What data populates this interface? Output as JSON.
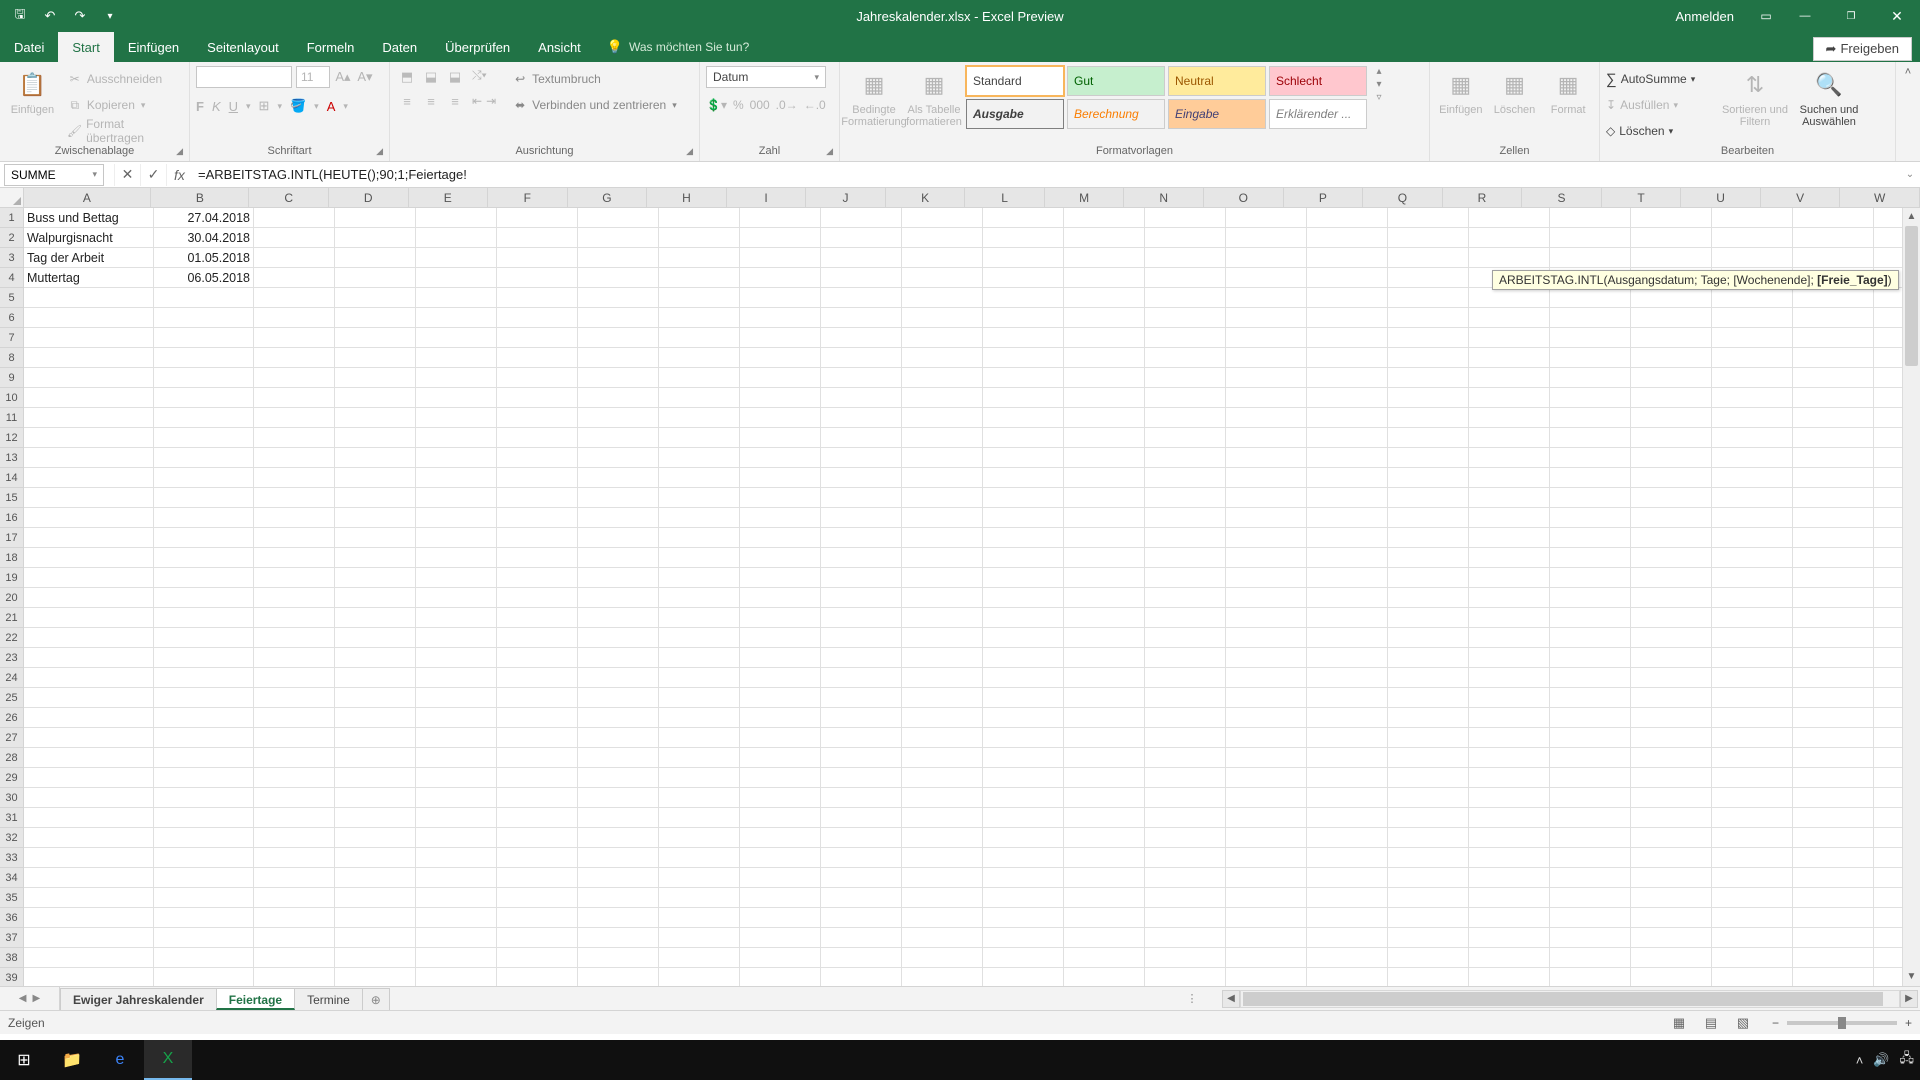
{
  "titlebar": {
    "title": "Jahreskalender.xlsx - Excel Preview",
    "anmelden": "Anmelden"
  },
  "tabs": {
    "file": "Datei",
    "start": "Start",
    "einfuegen": "Einfügen",
    "seitenlayout": "Seitenlayout",
    "formeln": "Formeln",
    "daten": "Daten",
    "ueberpruefen": "Überprüfen",
    "ansicht": "Ansicht",
    "tellme": "Was möchten Sie tun?",
    "share": "Freigeben"
  },
  "ribbon": {
    "clipboard": {
      "label": "Zwischenablage",
      "einfuegen": "Einfügen",
      "ausschneiden": "Ausschneiden",
      "kopieren": "Kopieren",
      "format": "Format übertragen"
    },
    "font": {
      "label": "Schriftart",
      "name": "",
      "size": "11"
    },
    "alignment": {
      "label": "Ausrichtung",
      "wrap": "Textumbruch",
      "merge": "Verbinden und zentrieren"
    },
    "number": {
      "label": "Zahl",
      "format": "Datum"
    },
    "styles": {
      "label": "Formatvorlagen",
      "bedingte": "Bedingte Formatierung",
      "alstabelle": "Als Tabelle formatieren",
      "items": {
        "standard": "Standard",
        "gut": "Gut",
        "neutral": "Neutral",
        "schlecht": "Schlecht",
        "ausgabe": "Ausgabe",
        "berechnung": "Berechnung",
        "eingabe": "Eingabe",
        "erklaerender": "Erklärender ..."
      }
    },
    "cells": {
      "label": "Zellen",
      "einfuegen": "Einfügen",
      "loeschen": "Löschen",
      "format": "Format"
    },
    "editing": {
      "label": "Bearbeiten",
      "autosum": "AutoSumme",
      "fill": "Ausfüllen",
      "clear": "Löschen",
      "sort": "Sortieren und Filtern",
      "find": "Suchen und Auswählen"
    }
  },
  "formulabar": {
    "namebox": "SUMME",
    "formula": "=ARBEITSTAG.INTL(HEUTE();90;1;Feiertage!"
  },
  "tooltip": {
    "text_prefix": "ARBEITSTAG.INTL(Ausgangsdatum; Tage; [Wochenende]; ",
    "text_bold": "[Freie_Tage]",
    "text_suffix": ")"
  },
  "columns": [
    "A",
    "B",
    "C",
    "D",
    "E",
    "F",
    "G",
    "H",
    "I",
    "J",
    "K",
    "L",
    "M",
    "N",
    "O",
    "P",
    "Q",
    "R",
    "S",
    "T",
    "U",
    "V",
    "W"
  ],
  "rows": [
    {
      "n": "1",
      "A": "Buss und Bettag",
      "B": "27.04.2018"
    },
    {
      "n": "2",
      "A": "Walpurgisnacht",
      "B": "30.04.2018"
    },
    {
      "n": "3",
      "A": "Tag der Arbeit",
      "B": "01.05.2018"
    },
    {
      "n": "4",
      "A": "Muttertag",
      "B": "06.05.2018"
    }
  ],
  "blank_rows": [
    "5",
    "6",
    "7",
    "8",
    "9",
    "10",
    "11",
    "12",
    "13",
    "14",
    "15",
    "16",
    "17",
    "18",
    "19",
    "20",
    "21",
    "22",
    "23",
    "24",
    "25",
    "26",
    "27",
    "28",
    "29",
    "30",
    "31",
    "32",
    "33",
    "34",
    "35",
    "36",
    "37",
    "38",
    "39"
  ],
  "sheets": {
    "s1": "Ewiger Jahreskalender",
    "s2": "Feiertage",
    "s3": "Termine"
  },
  "statusbar": {
    "mode": "Zeigen"
  }
}
